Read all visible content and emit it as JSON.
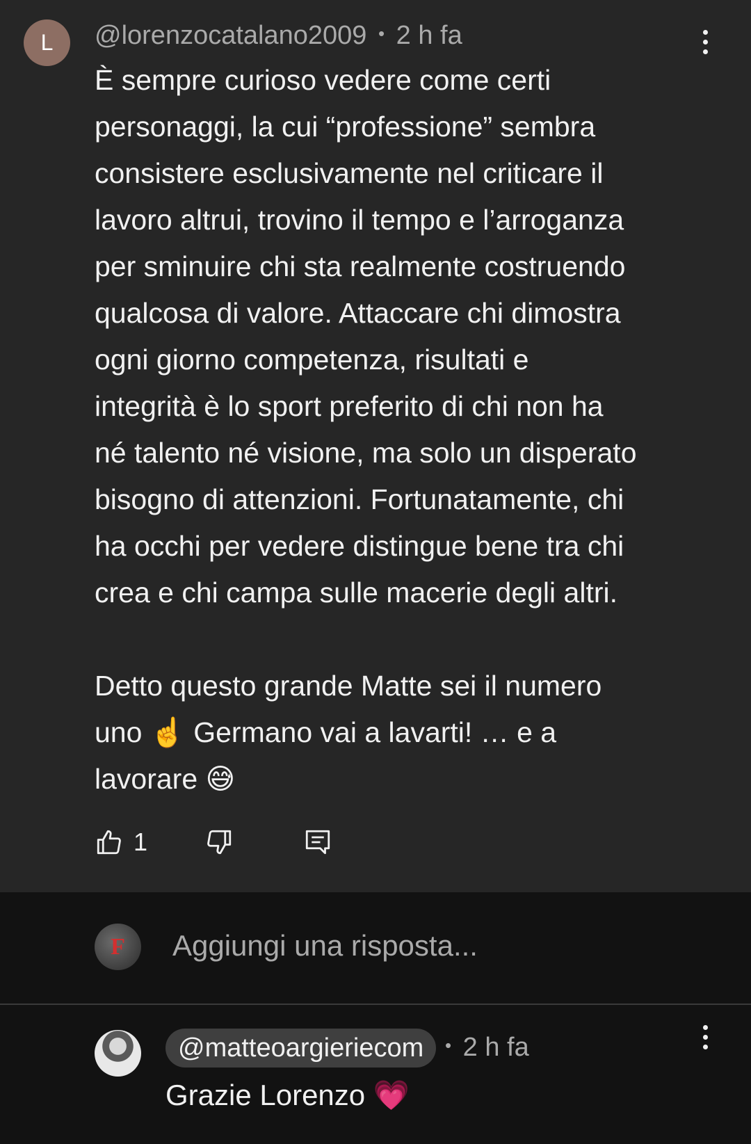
{
  "comment": {
    "avatar_letter": "L",
    "author": "@lorenzocatalano2009",
    "separator": "•",
    "time": "2 h fa",
    "text": "È sempre curioso vedere come certi\npersonaggi, la cui “professione” sembra\nconsistere esclusivamente nel criticare il\nlavoro altrui, trovino il tempo e l’arroganza\nper sminuire chi sta realmente costruendo\nqualcosa di valore. Attaccare chi dimostra\nogni giorno competenza, risultati e\nintegrità è lo sport preferito di chi non ha\nné talento né visione, ma solo un disperato\nbisogno di attenzioni. Fortunatamente, chi\nha occhi per vedere distingue bene tra chi\ncrea e chi campa sulle macerie degli altri.\n\nDetto questo grande Matte sei il numero\nuno ☝️ Germano vai a lavarti! … e a\nlavorare 😅",
    "like_count": "1",
    "icons": {
      "like": "thumbs-up-icon",
      "dislike": "thumbs-down-icon",
      "reply": "comment-icon",
      "menu": "more-vertical-icon"
    }
  },
  "reply_bar": {
    "avatar_letter": "F",
    "placeholder": "Aggiungi una risposta..."
  },
  "reply": {
    "author": "@matteoargieriecom",
    "separator": "•",
    "time": "2 h fa",
    "text": "Grazie Lorenzo 💗"
  },
  "colors": {
    "comment_bg": "#262626",
    "page_bg": "#121212",
    "text_primary": "#f1f1f1",
    "text_secondary": "#aaaaaa",
    "author_chip": "#3f3f3f",
    "avatar_l": "#8d6e63"
  }
}
